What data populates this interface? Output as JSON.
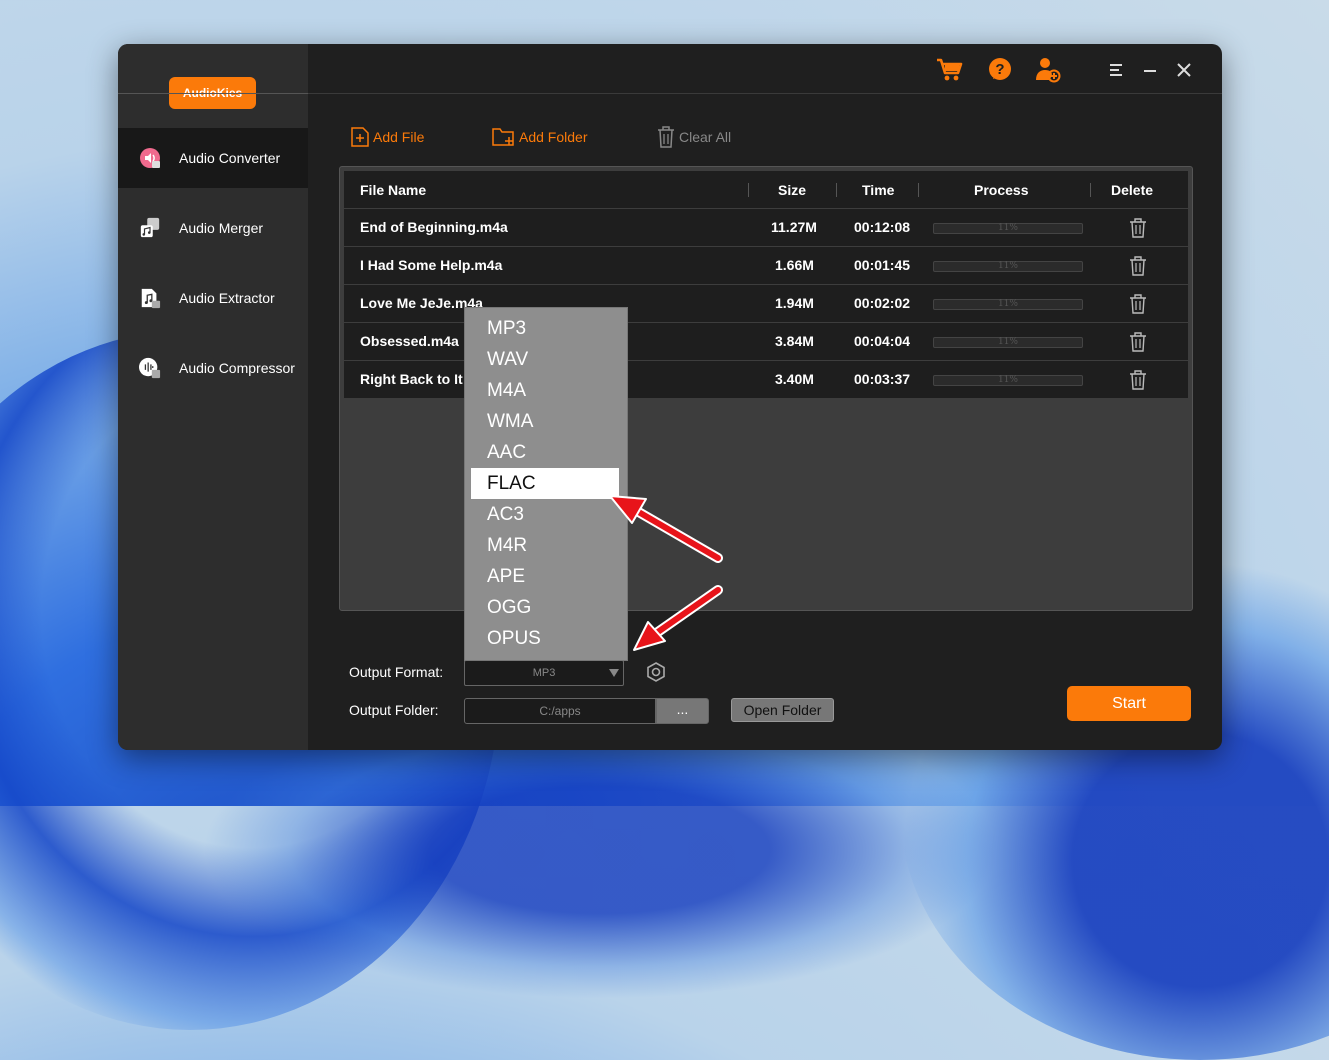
{
  "brand": "AudioKies",
  "nav": [
    {
      "label": "Audio Converter",
      "icon": "audio-converter-icon",
      "active": true
    },
    {
      "label": "Audio Merger",
      "icon": "audio-merger-icon",
      "active": false
    },
    {
      "label": "Audio Extractor",
      "icon": "audio-extractor-icon",
      "active": false
    },
    {
      "label": "Audio Compressor",
      "icon": "audio-compressor-icon",
      "active": false
    }
  ],
  "toolbar": {
    "add_file": "Add File",
    "add_folder": "Add Folder",
    "clear_all": "Clear All"
  },
  "table": {
    "headers": {
      "name": "File Name",
      "size": "Size",
      "time": "Time",
      "process": "Process",
      "delete": "Delete"
    },
    "rows": [
      {
        "name": "End of Beginning.m4a",
        "size": "11.27M",
        "time": "00:12:08",
        "progress": "11%"
      },
      {
        "name": "I Had Some Help.m4a",
        "size": "1.66M",
        "time": "00:01:45",
        "progress": "11%"
      },
      {
        "name": "Love Me JeJe.m4a",
        "size": "1.94M",
        "time": "00:02:02",
        "progress": "11%"
      },
      {
        "name": "Obsessed.m4a",
        "size": "3.84M",
        "time": "00:04:04",
        "progress": "11%"
      },
      {
        "name": "Right Back to It",
        "size": "3.40M",
        "time": "00:03:37",
        "progress": "11%"
      }
    ]
  },
  "output": {
    "format_label": "Output Format:",
    "format_value": "MP3",
    "folder_label": "Output Folder:",
    "folder_value": "C:/apps",
    "browse": "...",
    "open_folder": "Open Folder",
    "start": "Start"
  },
  "dropdown": {
    "options": [
      "MP3",
      "WAV",
      "M4A",
      "WMA",
      "AAC",
      "FLAC",
      "AC3",
      "M4R",
      "APE",
      "OGG",
      "OPUS"
    ],
    "highlighted": "FLAC"
  },
  "colors": {
    "accent": "#fb7a0a",
    "background": "#1f1f1f",
    "sidebar": "#2d2d2d",
    "arrow": "#e8141a"
  }
}
